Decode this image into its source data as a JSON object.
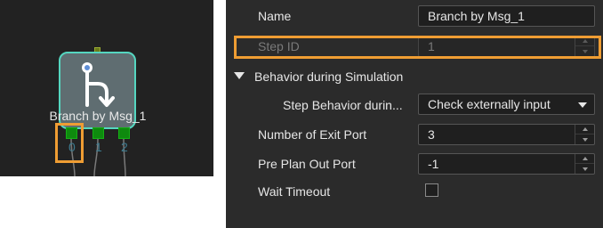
{
  "node": {
    "label": "Branch by Msg_1",
    "ports": [
      "0",
      "1",
      "2"
    ],
    "icon": "branch-arrow-icon",
    "accent_color": "#55d6c0",
    "port_color": "#0e8a0e",
    "highlight_color": "#ef9d33"
  },
  "properties": {
    "name": {
      "label": "Name",
      "value": "Branch by Msg_1"
    },
    "step_id": {
      "label": "Step ID",
      "value": "1"
    },
    "section": {
      "label": "Behavior during Simulation"
    },
    "step_behavior": {
      "label": "Step Behavior durin...",
      "value": "Check externally input"
    },
    "exit_ports": {
      "label": "Number of Exit Port",
      "value": "3"
    },
    "pre_plan": {
      "label": "Pre Plan Out Port",
      "value": "-1"
    },
    "wait_timeout": {
      "label": "Wait Timeout",
      "checked": false
    }
  }
}
